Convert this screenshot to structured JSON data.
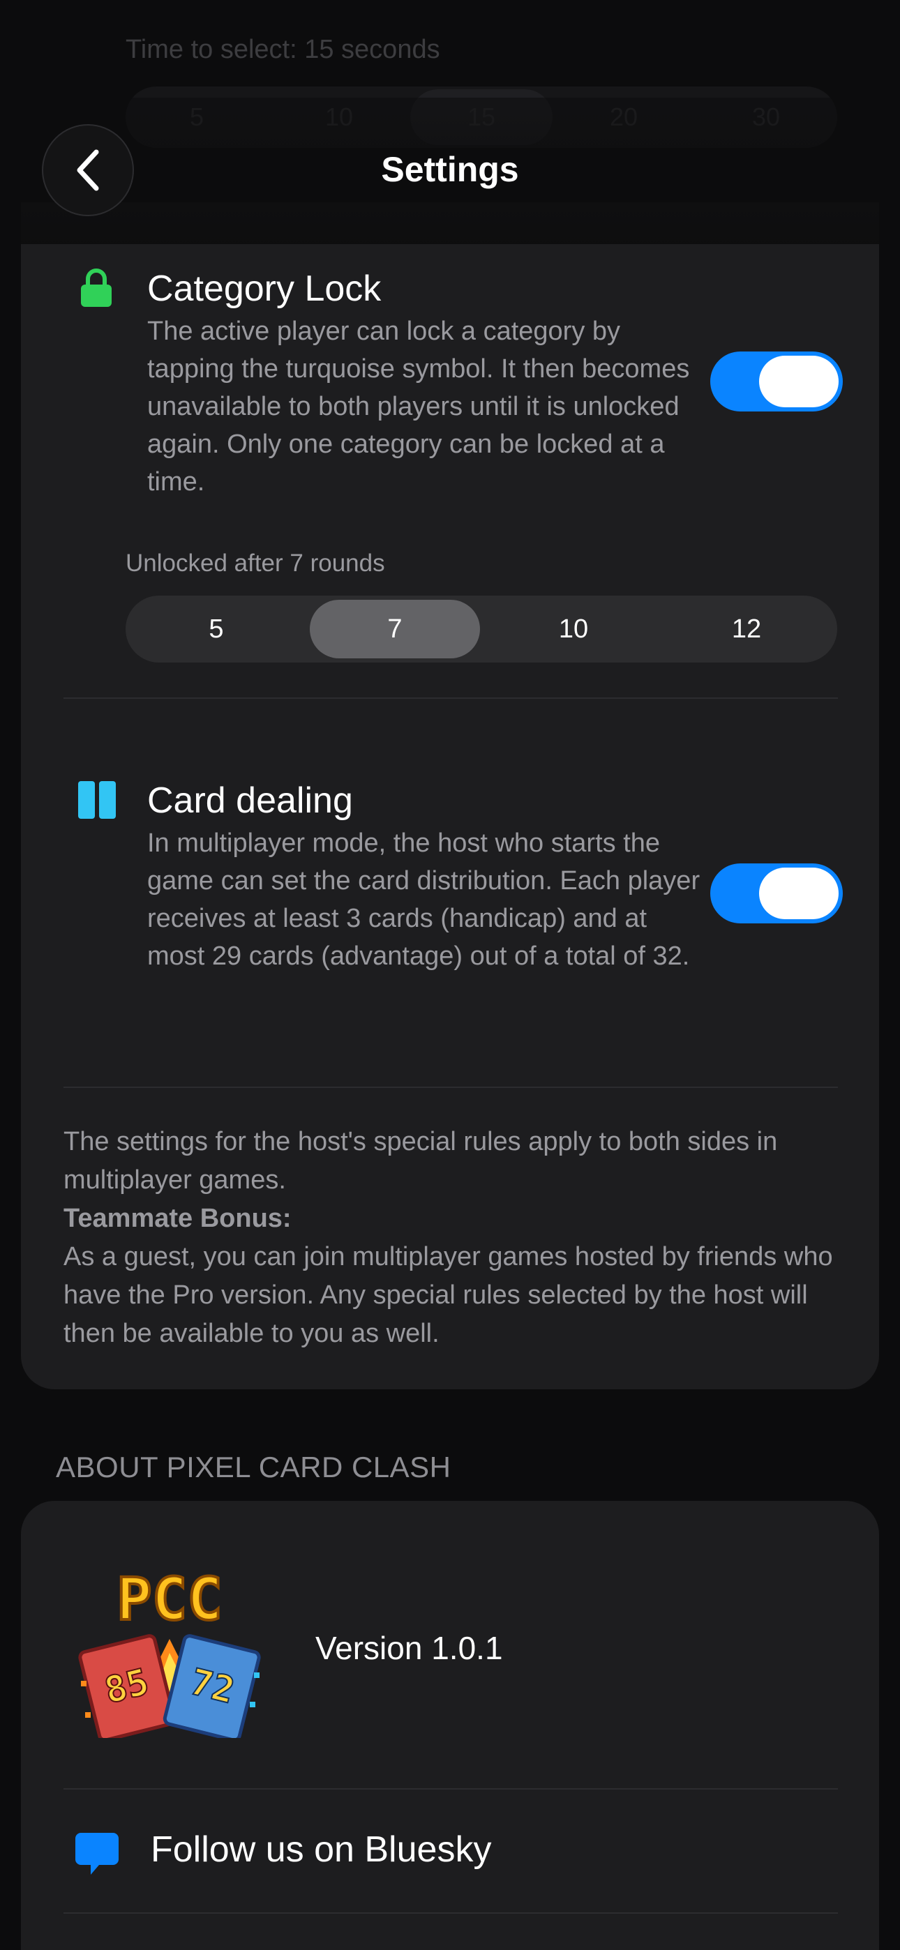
{
  "header": {
    "title": "Settings"
  },
  "ghost": {
    "label": "Time to select: 15 seconds",
    "options": [
      "5",
      "10",
      "15",
      "20",
      "30"
    ]
  },
  "category_lock": {
    "title": "Category Lock",
    "description": "The active player can lock a category by tapping the turquoise symbol. It then becomes unavailable to both players until it is unlocked again. Only one category can be locked at a time.",
    "enabled": true,
    "icon": "lock-icon",
    "icon_color": "#30d158",
    "unlock_label": "Unlocked after 7 rounds",
    "rounds_options": [
      "5",
      "7",
      "10",
      "12"
    ],
    "rounds_selected": "7"
  },
  "card_dealing": {
    "title": "Card dealing",
    "description": "In multiplayer mode, the host who starts the game can set the card distribution. Each player receives at least 3 cards (handicap) and at most 29 cards (advantage) out of a total of 32.",
    "enabled": true,
    "icon": "cards-icon",
    "icon_color": "#32c5f4"
  },
  "footer": {
    "text1": "The settings for the host's special rules apply to both sides in multiplayer games.",
    "bonus_title": "Teammate Bonus:",
    "text2": "As a guest, you can join multiplayer games hosted by friends who have the Pro version. Any special rules selected by the host will then be available to you as well."
  },
  "about": {
    "section_title": "ABOUT PIXEL CARD CLASH",
    "logo_text": "PCC",
    "card_left": "85",
    "card_right": "72",
    "version": "Version 1.0.1",
    "follow_label": "Follow us on Bluesky",
    "follow_icon": "chat-bubble-icon"
  },
  "colors": {
    "accent": "#0a84ff",
    "background": "#0c0c0d",
    "card": "#1d1d1f"
  }
}
